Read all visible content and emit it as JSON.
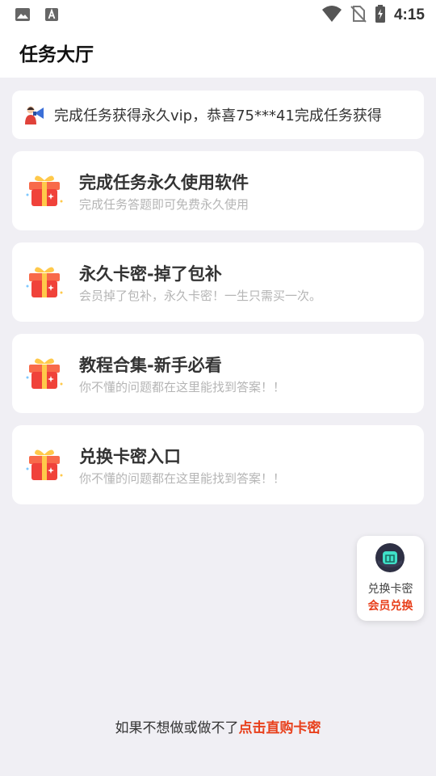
{
  "status_bar": {
    "time": "4:15",
    "icons_left": [
      "image-icon",
      "a-notification-icon"
    ],
    "icons_right": [
      "wifi-icon",
      "no-sim-icon",
      "battery-charging-icon"
    ]
  },
  "app_bar": {
    "title": "任务大厅"
  },
  "ticker": {
    "text": "完成任务获得永久vip，恭喜75***41完成任务获得"
  },
  "cards": [
    {
      "title": "完成任务永久使用软件",
      "subtitle": "完成任务答题即可免费永久使用",
      "icon": "gift-box-icon"
    },
    {
      "title": "永久卡密-掉了包补",
      "subtitle": "会员掉了包补，永久卡密！一生只需买一次。",
      "icon": "gift-box-icon"
    },
    {
      "title": "教程合集-新手必看",
      "subtitle": "你不懂的问题都在这里能找到答案！！",
      "icon": "gift-box-icon"
    },
    {
      "title": "兑换卡密入口",
      "subtitle": "你不懂的问题都在这里能找到答案！！",
      "icon": "gift-box-icon"
    }
  ],
  "float_button": {
    "line1": "兑换卡密",
    "line2": "会员兑换"
  },
  "footer": {
    "text": "如果不想做或做不了",
    "link": "点击直购卡密"
  },
  "colors": {
    "accent": "#e8401c",
    "background": "#f0eff4",
    "gift_red": "#f0423a",
    "gift_ribbon": "#ffc94a"
  }
}
